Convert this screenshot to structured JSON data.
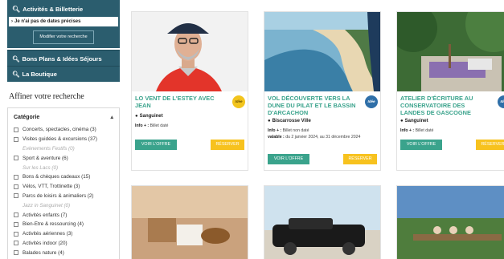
{
  "sidebar": {
    "activities_label": "Activités & Billetterie",
    "no_dates_label": "Je n'ai pas de dates précises",
    "modify_button": "Modifier votre recherche",
    "bons_plans_label": "Bons Plans & Idées Séjours",
    "boutique_label": "La Boutique",
    "refine_title": "Affiner votre recherche",
    "category_title": "Catégorie",
    "categories": [
      {
        "label": "Concerts, spectacles, cinéma (3)",
        "enabled": true
      },
      {
        "label": "Visites guidées & excursions (37)",
        "enabled": true
      },
      {
        "label": "Evènements Festifs (0)",
        "enabled": false
      },
      {
        "label": "Sport & aventure (6)",
        "enabled": true
      },
      {
        "label": "Sur les Lacs (0)",
        "enabled": false
      },
      {
        "label": "Bons & chèques cadeaux (15)",
        "enabled": true
      },
      {
        "label": "Vélos, VTT, Trottinette (3)",
        "enabled": true
      },
      {
        "label": "Parcs de loisirs & animaliers (2)",
        "enabled": true
      },
      {
        "label": "Jazz in Sanguinet (0)",
        "enabled": false
      },
      {
        "label": "Activités enfants (7)",
        "enabled": true
      },
      {
        "label": "Bien-Etre & ressourcing (4)",
        "enabled": true
      },
      {
        "label": "Activités aériennes (3)",
        "enabled": true
      },
      {
        "label": "Activités indoor (20)",
        "enabled": true
      },
      {
        "label": "Balades nature (4)",
        "enabled": true
      }
    ]
  },
  "cards": [
    {
      "title": "LO VENT DE L'ESTEY AVEC JEAN",
      "location": "Sanguinet",
      "info_label": "Info + :",
      "info_value": "Billet daté",
      "valid_label": "",
      "valid_value": "",
      "badge": "Idée",
      "badge_color": "#f2c41d",
      "offer_button": "VOIR L'OFFRE",
      "reserve_button": "RÉSERVER"
    },
    {
      "title": "VOL DÉCOUVERTE VERS LA DUNE DU PILAT ET LE BASSIN D'ARCACHON",
      "location": "Biscarrosse Ville",
      "info_label": "Info + :",
      "info_value": "Billet non daté",
      "valid_label": "valable :",
      "valid_value": "du 2 janvier 2024, au 31 décembre 2024",
      "badge": "Idée",
      "badge_color": "#2f6fa8",
      "offer_button": "VOIR L'OFFRE",
      "reserve_button": "RÉSERVER"
    },
    {
      "title": "ATELIER D'ÉCRITURE AU CONSERVATOIRE DES LANDES DE GASCOGNE",
      "location": "Sanguinet",
      "info_label": "Info + :",
      "info_value": "Billet daté",
      "valid_label": "",
      "valid_value": "",
      "badge": "Idée",
      "badge_color": "#2f6fa8",
      "offer_button": "VOIR L'OFFRE",
      "reserve_button": "RÉSERVER"
    }
  ]
}
